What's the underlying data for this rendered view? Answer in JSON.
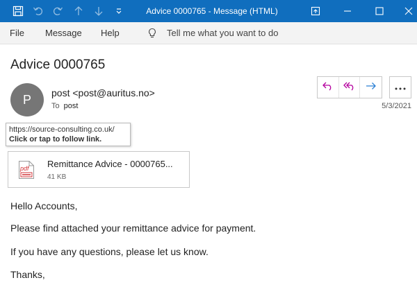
{
  "window": {
    "title": "Advice 0000765  -  Message (HTML)",
    "accent_color": "#106ebe",
    "title_icons": [
      "save-icon",
      "undo-icon",
      "redo-icon",
      "arrow-up-icon",
      "arrow-down-icon",
      "customize-toolbar-icon"
    ],
    "window_controls": [
      "restore-window-icon",
      "minimize-icon",
      "maximize-icon",
      "close-icon"
    ]
  },
  "menu": {
    "items": [
      "File",
      "Message",
      "Help"
    ],
    "tell_me": "Tell me what you want to do"
  },
  "message": {
    "subject": "Advice 0000765",
    "avatar_initial": "P",
    "sender": "post <post@auritus.no>",
    "to_label": "To",
    "to_name": "post",
    "date": "5/3/2021"
  },
  "tooltip": {
    "url": "https://source-consulting.co.uk/",
    "hint": "Click or tap to follow link."
  },
  "attachment": {
    "icon_label": "pdf",
    "name": "Remittance Advice - 0000765...",
    "size": "41 KB"
  },
  "body": {
    "lines": [
      "Hello Accounts,",
      "Please find attached your remittance advice for payment.",
      "If you have any questions, please let us know.",
      "Thanks,"
    ]
  }
}
